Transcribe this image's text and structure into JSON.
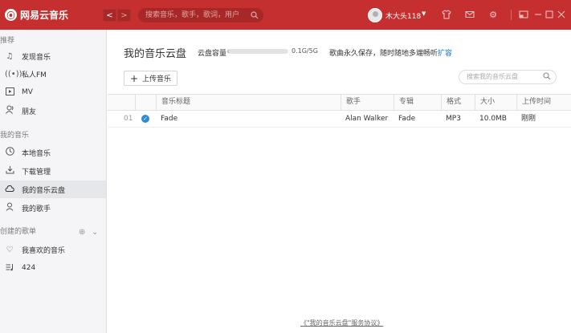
{
  "app": {
    "name": "网易云音乐",
    "logo_glyph": "⦿"
  },
  "topbar": {
    "back": "<",
    "forward": ">",
    "search_placeholder": "搜索音乐，歌手，歌词，用户",
    "username": "木大头118",
    "icons": [
      "skin-icon",
      "mail-icon",
      "settings-icon",
      "mini-mode-icon",
      "minimize-icon",
      "maximize-icon",
      "close-icon"
    ]
  },
  "sidebar": {
    "section_recommend": "推荐",
    "discover": "发现音乐",
    "fm": "私人FM",
    "mv": "MV",
    "friends": "朋友",
    "section_my_music": "我的音乐",
    "local": "本地音乐",
    "downloads": "下载管理",
    "cloud": "我的音乐云盘",
    "artists": "我的歌手",
    "section_playlists": "创建的歌单",
    "liked": "我喜欢的音乐",
    "playlist_424": "424"
  },
  "main": {
    "title": "我的音乐云盘",
    "capacity_label": "云盘容量",
    "capacity_fraction": 0.02,
    "capacity_text": "0.1G/5G",
    "capacity_note": "歌曲永久保存，随时随地多端畅听",
    "expand_link": "扩容",
    "upload_button": "上传音乐",
    "search_placeholder": "搜索我的音乐云盘",
    "columns": {
      "title": "音乐标题",
      "artist": "歌手",
      "album": "专辑",
      "format": "格式",
      "size": "大小",
      "upload_time": "上传时间"
    },
    "rows": [
      {
        "index": "01",
        "title": "Fade",
        "artist": "Alan Walker",
        "album": "Fade",
        "format": "MP3",
        "size": "10.0MB",
        "upload_time": "刚刚"
      }
    ],
    "footer_link": "《\"我的音乐云盘\"服务协议》"
  },
  "colors": {
    "brand": "#c62f2f",
    "link": "#0c73c2",
    "check": "#2a8bd9"
  }
}
